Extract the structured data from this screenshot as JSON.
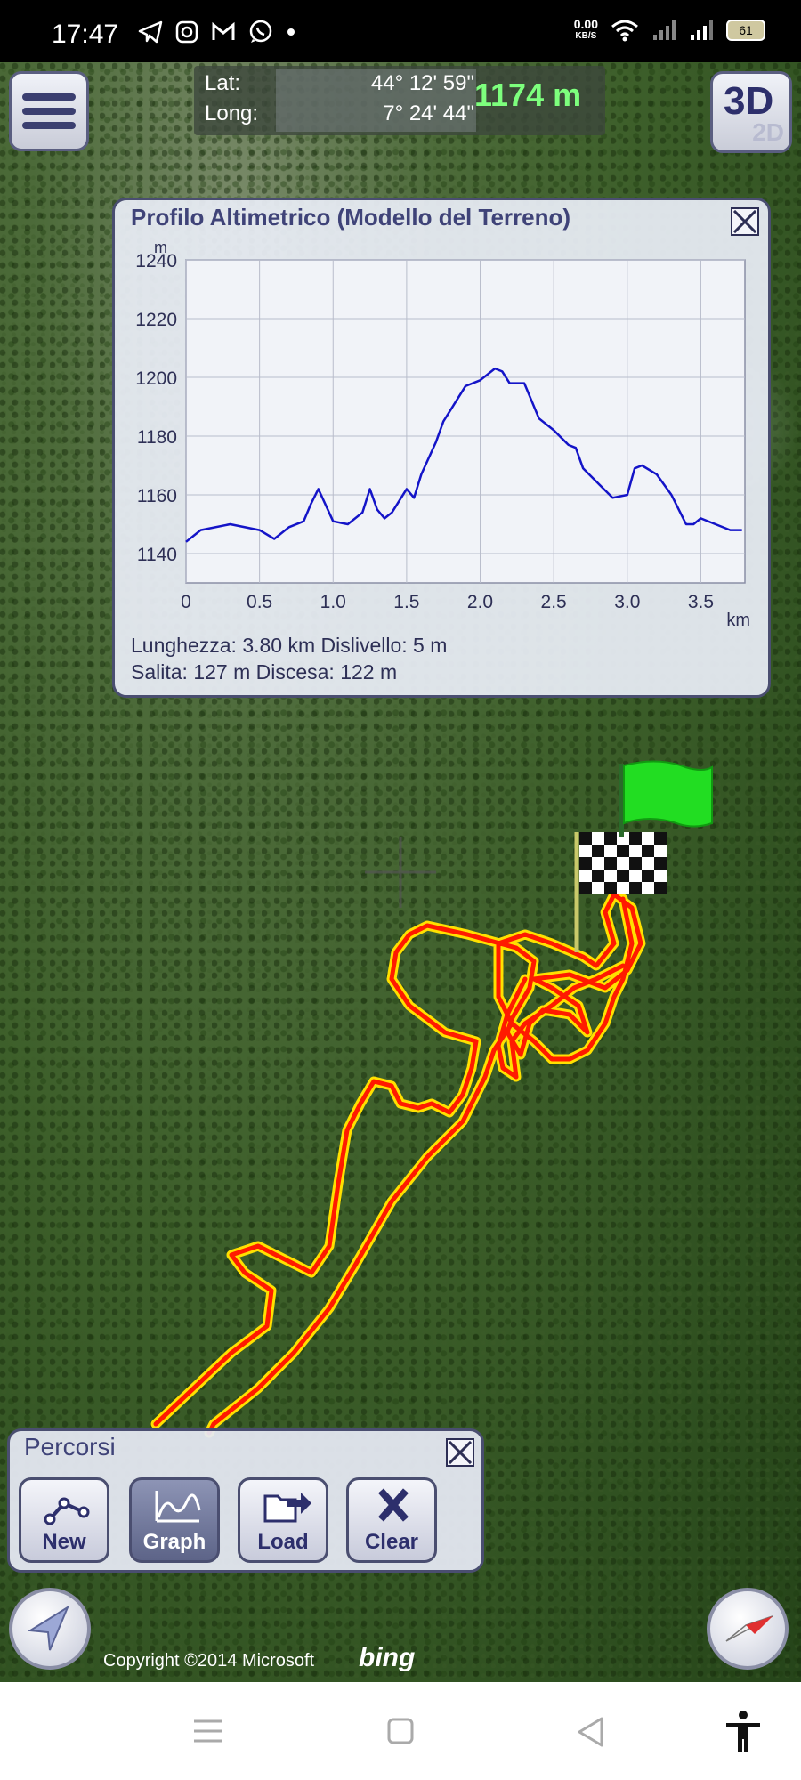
{
  "status_bar": {
    "time": "17:47",
    "speed_value": "0.00",
    "speed_unit": "KB/S",
    "battery": "61",
    "icons": [
      "telegram-icon",
      "instagram-icon",
      "gmail-icon",
      "whatsapp-icon",
      "dot-icon",
      "wifi-icon",
      "signal-icon",
      "signal-icon",
      "battery-icon"
    ]
  },
  "coordinates": {
    "lat_label": "Lat:",
    "lat_value": "44° 12' 59\"",
    "long_label": "Long:",
    "long_value": "7° 24' 44\"",
    "altitude": "1174 m"
  },
  "view_toggle": {
    "primary": "3D",
    "secondary": "2D"
  },
  "profile_panel": {
    "title": "Profilo Altimetrico (Modello del Terreno)",
    "line1": "Lunghezza: 3.80 km   Dislivello: 5 m",
    "line2": "Salita: 127 m    Discesa: 122 m"
  },
  "chart_data": {
    "type": "line",
    "xlabel": "km",
    "ylabel": "m",
    "xlim": [
      0,
      3.8
    ],
    "ylim": [
      1130,
      1240
    ],
    "x_ticks": [
      "0",
      "0.5",
      "1.0",
      "1.5",
      "2.0",
      "2.5",
      "3.0",
      "3.5"
    ],
    "y_ticks": [
      "1240",
      "1220",
      "1200",
      "1180",
      "1160",
      "1140"
    ],
    "grid": true,
    "series": [
      {
        "color": "#1414c8",
        "x": [
          0.0,
          0.1,
          0.3,
          0.5,
          0.6,
          0.7,
          0.8,
          0.85,
          0.9,
          1.0,
          1.1,
          1.2,
          1.25,
          1.3,
          1.35,
          1.4,
          1.5,
          1.55,
          1.6,
          1.7,
          1.75,
          1.8,
          1.9,
          2.0,
          2.1,
          2.15,
          2.2,
          2.3,
          2.4,
          2.5,
          2.6,
          2.65,
          2.7,
          2.8,
          2.9,
          3.0,
          3.05,
          3.1,
          3.2,
          3.3,
          3.4,
          3.45,
          3.5,
          3.6,
          3.7,
          3.78
        ],
        "values": [
          1144,
          1148,
          1150,
          1148,
          1145,
          1149,
          1151,
          1157,
          1162,
          1151,
          1150,
          1154,
          1162,
          1155,
          1152,
          1154,
          1162,
          1159,
          1167,
          1178,
          1185,
          1189,
          1197,
          1199,
          1203,
          1202,
          1198,
          1198,
          1186,
          1182,
          1177,
          1176,
          1169,
          1164,
          1159,
          1160,
          1169,
          1170,
          1167,
          1160,
          1150,
          1150,
          1152,
          1150,
          1148,
          1148
        ]
      }
    ]
  },
  "percorsi_panel": {
    "title": "Percorsi",
    "buttons": [
      {
        "label": "New",
        "icon": "new-route-icon"
      },
      {
        "label": "Graph",
        "icon": "graph-icon",
        "active": true
      },
      {
        "label": "Load",
        "icon": "load-folder-icon"
      },
      {
        "label": "Clear",
        "icon": "clear-x-icon"
      }
    ]
  },
  "map": {
    "copyright": "Copyright ©2014 Microsoft",
    "provider": "bing",
    "track_color": "#ff2200",
    "track_outline": "#ffe000",
    "flag_color": "#22dd22"
  },
  "nav_bar": {
    "icons": [
      "menu-lines-icon",
      "home-square-icon",
      "back-triangle-icon",
      "accessibility-icon"
    ]
  }
}
